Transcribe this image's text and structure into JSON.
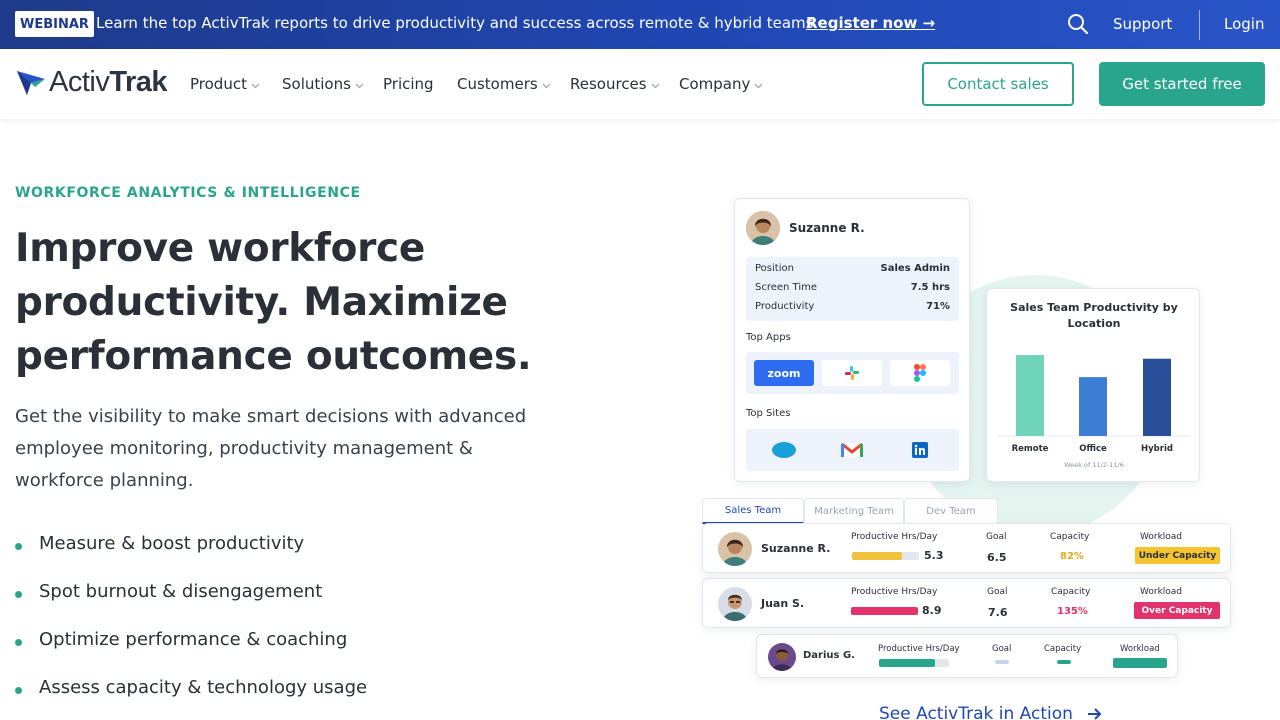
{
  "banner": {
    "badge": "WEBINAR",
    "text": "Learn the top ActivTrak reports to drive productivity and success across remote & hybrid teams –",
    "link": "Register now →",
    "search_icon": "search-icon",
    "support": "Support",
    "login": "Login"
  },
  "nav": {
    "logo_a": "Activ",
    "logo_b": "Trak",
    "items": [
      "Product",
      "Solutions",
      "Pricing",
      "Customers",
      "Resources",
      "Company"
    ],
    "contact": "Contact sales",
    "get_started": "Get started free"
  },
  "hero": {
    "eyebrow": "WORKFORCE ANALYTICS & INTELLIGENCE",
    "headline": "Improve workforce productivity. Maximize performance outcomes.",
    "subcopy": "Get the visibility to make smart decisions with advanced employee monitoring, productivity management & workforce planning.",
    "bullets": [
      "Measure & boost productivity",
      "Spot burnout & disengagement",
      "Optimize performance & coaching",
      "Assess capacity & technology usage"
    ],
    "cta": "See ActivTrak in Action"
  },
  "profile": {
    "name": "Suzanne R.",
    "stats": [
      {
        "label": "Position",
        "value": "Sales Admin"
      },
      {
        "label": "Screen Time",
        "value": "7.5 hrs"
      },
      {
        "label": "Productivity",
        "value": "71%"
      }
    ],
    "top_apps_label": "Top Apps",
    "top_apps": [
      "zoom",
      "slack-icon",
      "figma-icon"
    ],
    "top_sites_label": "Top Sites",
    "top_sites": [
      "salesforce-icon",
      "gmail-icon",
      "linkedin-icon"
    ]
  },
  "chart_data": {
    "type": "bar",
    "title": "Sales Team Productivity by Location",
    "categories": [
      "Remote",
      "Office",
      "Hybrid"
    ],
    "values": [
      88,
      64,
      84
    ],
    "colors": [
      "#6fd4b8",
      "#3d7dd4",
      "#2a4f9a"
    ],
    "ylim": [
      0,
      100
    ],
    "footnote": "Week of 11/2-11/6"
  },
  "team_tabs": [
    "Sales Team",
    "Marketing Team",
    "Dev Team"
  ],
  "team_headers": {
    "hours": "Productive Hrs/Day",
    "goal": "Goal",
    "capacity": "Capacity",
    "workload": "Workload"
  },
  "team_rows": [
    {
      "name": "Suzanne R.",
      "hours": "5.3",
      "goal": "6.5",
      "capacity": "82%",
      "workload": "Under Capacity",
      "bar_fraction": 0.74,
      "bar_color": "#f0c23b",
      "capacity_color": "#e0a91e",
      "pill_bg": "#f5c52f",
      "pill_fg": "#2b2f38"
    },
    {
      "name": "Juan S.",
      "hours": "8.9",
      "goal": "7.6",
      "capacity": "135%",
      "workload": "Over Capacity",
      "bar_fraction": 1.0,
      "bar_color": "#e2336b",
      "capacity_color": "#e2336b",
      "pill_bg": "#e2336b",
      "pill_fg": "#ffffff"
    },
    {
      "name": "Darius G.",
      "hours": "",
      "goal": "",
      "capacity": "",
      "workload": "",
      "bar_fraction": 0.8,
      "bar_color": "#2aa58d",
      "capacity_color": "#2aa58d",
      "pill_bg": "#2aa58d",
      "pill_fg": "#ffffff"
    }
  ],
  "colors": {
    "accent": "#2aa58d",
    "brand_blue": "#1f47b4",
    "banner": "#1e3a8a"
  }
}
